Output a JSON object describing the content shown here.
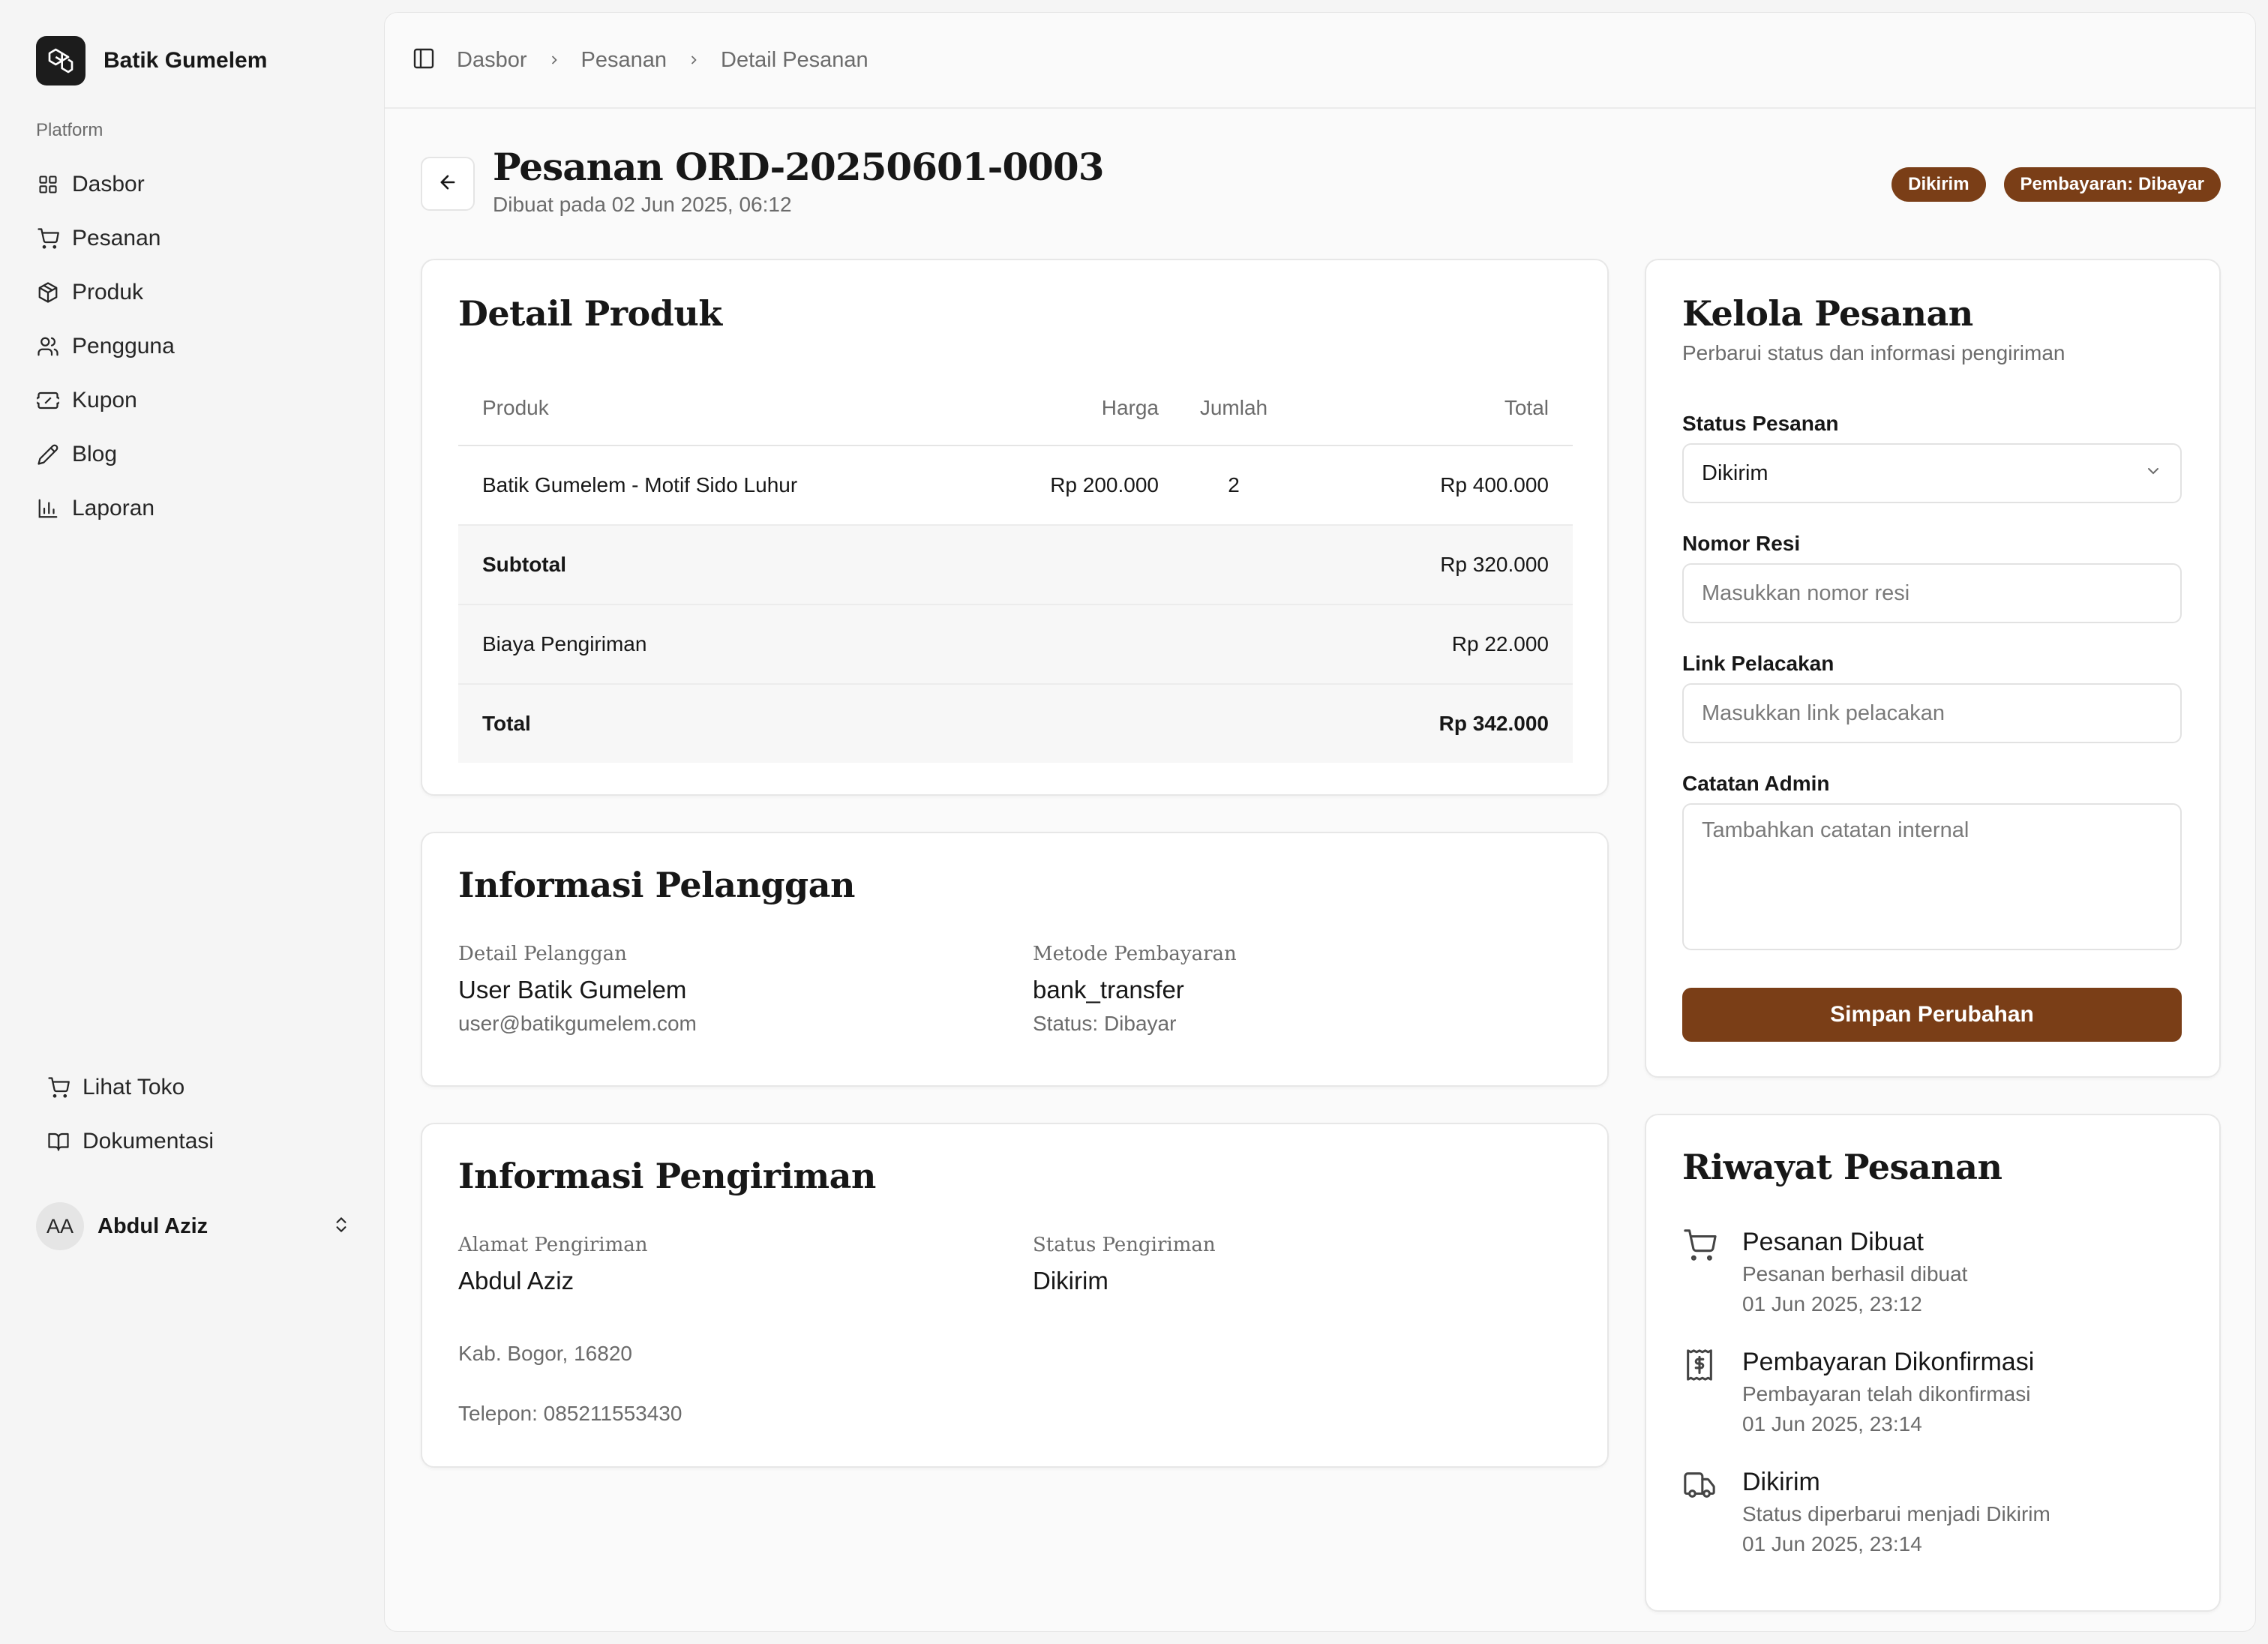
{
  "brand": {
    "name": "Batik Gumelem",
    "logo_icon": "logo-icon"
  },
  "sidebar": {
    "group_label": "Platform",
    "items": [
      {
        "label": "Dasbor",
        "icon": "grid-icon"
      },
      {
        "label": "Pesanan",
        "icon": "cart-icon"
      },
      {
        "label": "Produk",
        "icon": "box-icon"
      },
      {
        "label": "Pengguna",
        "icon": "users-icon"
      },
      {
        "label": "Kupon",
        "icon": "ticket-icon"
      },
      {
        "label": "Blog",
        "icon": "pencil-icon"
      },
      {
        "label": "Laporan",
        "icon": "bar-chart-icon"
      }
    ],
    "bottom_items": [
      {
        "label": "Lihat Toko",
        "icon": "cart-icon"
      },
      {
        "label": "Dokumentasi",
        "icon": "book-icon"
      }
    ],
    "user": {
      "initials": "AA",
      "name": "Abdul Aziz"
    }
  },
  "breadcrumb": [
    "Dasbor",
    "Pesanan",
    "Detail Pesanan"
  ],
  "header": {
    "title": "Pesanan ORD-20250601-0003",
    "subtitle": "Dibuat pada 02 Jun 2025, 06:12",
    "badges": [
      "Dikirim",
      "Pembayaran: Dibayar"
    ]
  },
  "product_detail": {
    "title": "Detail Produk",
    "columns": [
      "Produk",
      "Harga",
      "Jumlah",
      "Total"
    ],
    "rows": [
      {
        "product": "Batik Gumelem - Motif Sido Luhur",
        "price": "Rp 200.000",
        "qty": "2",
        "total": "Rp 400.000"
      }
    ],
    "summary": [
      {
        "label": "Subtotal",
        "value": "Rp 320.000"
      },
      {
        "label": "Biaya Pengiriman",
        "value": "Rp 22.000"
      },
      {
        "label": "Total",
        "value": "Rp 342.000"
      }
    ]
  },
  "customer": {
    "title": "Informasi Pelanggan",
    "detail_label": "Detail Pelanggan",
    "name": "User Batik Gumelem",
    "email": "user@batikgumelem.com",
    "payment_label": "Metode Pembayaran",
    "payment_method": "bank_transfer",
    "payment_status": "Status: Dibayar"
  },
  "shipping": {
    "title": "Informasi Pengiriman",
    "address_label": "Alamat Pengiriman",
    "recipient": "Abdul Aziz",
    "city": "Kab. Bogor, 16820",
    "phone": "Telepon: 085211553430",
    "status_label": "Status Pengiriman",
    "status": "Dikirim"
  },
  "manage": {
    "title": "Kelola Pesanan",
    "subtitle": "Perbarui status dan informasi pengiriman",
    "status_label": "Status Pesanan",
    "status_value": "Dikirim",
    "resi_label": "Nomor Resi",
    "resi_placeholder": "Masukkan nomor resi",
    "link_label": "Link Pelacakan",
    "link_placeholder": "Masukkan link pelacakan",
    "note_label": "Catatan Admin",
    "note_placeholder": "Tambahkan catatan internal",
    "save_label": "Simpan Perubahan"
  },
  "history": {
    "title": "Riwayat Pesanan",
    "items": [
      {
        "icon": "cart-icon",
        "title": "Pesanan Dibuat",
        "desc": "Pesanan berhasil dibuat",
        "time": "01 Jun 2025, 23:12"
      },
      {
        "icon": "receipt-icon",
        "title": "Pembayaran Dikonfirmasi",
        "desc": "Pembayaran telah dikonfirmasi",
        "time": "01 Jun 2025, 23:14"
      },
      {
        "icon": "truck-icon",
        "title": "Dikirim",
        "desc": "Status diperbarui menjadi Dikirim",
        "time": "01 Jun 2025, 23:14"
      }
    ]
  },
  "colors": {
    "accent": "#7a3e17",
    "background": "#f5f5f5",
    "card": "#ffffff"
  }
}
